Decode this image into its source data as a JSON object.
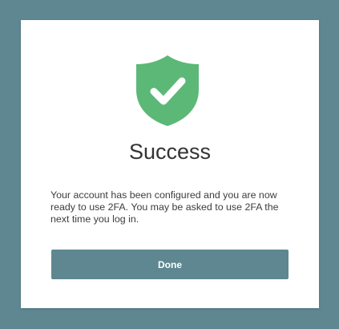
{
  "dialog": {
    "icon": "shield-check-icon",
    "title": "Success",
    "message": "Your account has been configured and you are now ready to use 2FA. You may be asked to use 2FA the next time you log in.",
    "done_label": "Done"
  },
  "colors": {
    "background": "#5e8791",
    "card": "#ffffff",
    "shield": "#5cb877",
    "button": "#5e8791",
    "button_text": "#ffffff"
  }
}
